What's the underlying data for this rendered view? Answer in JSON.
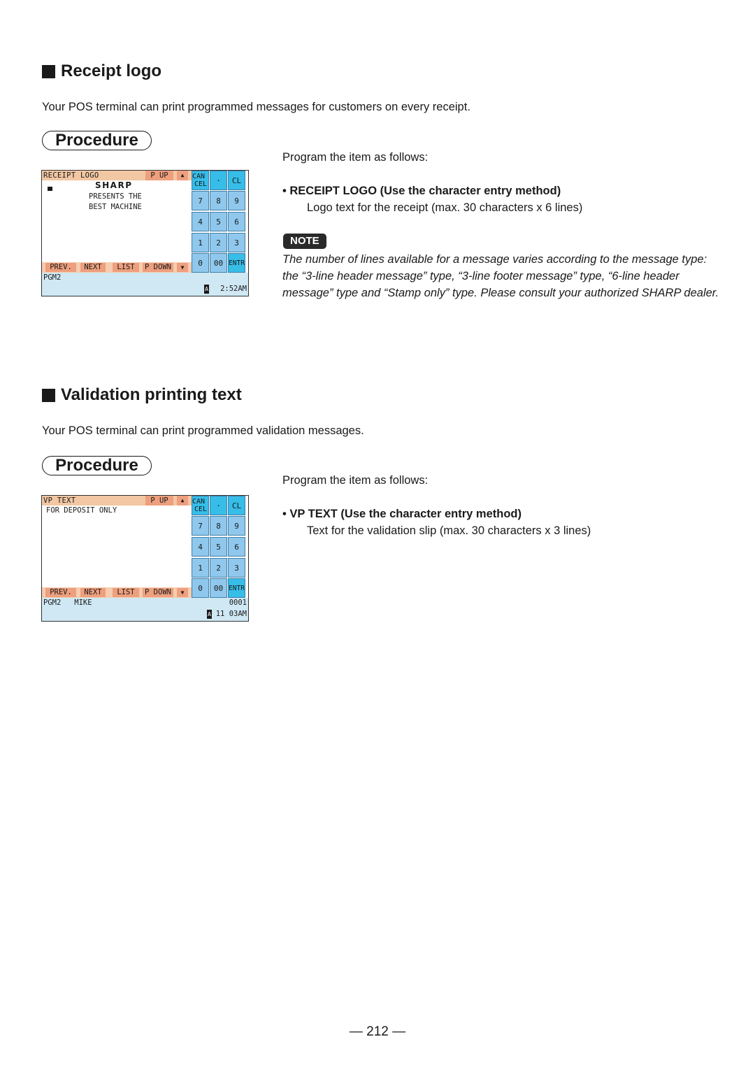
{
  "sections": [
    {
      "title": "Receipt logo",
      "intro": "Your POS terminal can print programmed messages for customers on every receipt.",
      "procedure_label": "Procedure",
      "program_text": "Program the item as follows:",
      "bullet_title": "RECEIPT LOGO (Use the character entry method)",
      "bullet_desc": "Logo text for the receipt (max. 30 characters x 6 lines)",
      "note_label": "NOTE",
      "note_text": "The number of lines available for a message varies according to the message type: the “3-line header message” type, “3-line footer message” type, “6-line header message” type and “Stamp only” type. Please consult your authorized SHARP dealer.",
      "screen": {
        "title": "RECEIPT LOGO",
        "content_lines": [
          "SHARP",
          "PRESENTS THE",
          "BEST MACHINE"
        ],
        "status_left": "PGM2",
        "status_right_top": "",
        "mode_indicator": "A",
        "time": "2:52AM"
      }
    },
    {
      "title": "Validation printing text",
      "intro": "Your POS terminal can print programmed validation messages.",
      "procedure_label": "Procedure",
      "program_text": "Program the item as follows:",
      "bullet_title": "VP TEXT (Use the character entry method)",
      "bullet_desc": "Text for the validation slip (max. 30 characters x 3 lines)",
      "screen": {
        "title": "VP TEXT",
        "content_lines": [
          "FOR DEPOSIT ONLY"
        ],
        "status_left": "PGM2   MIKE",
        "status_right_top": "0001",
        "mode_indicator": "A",
        "time": "11 03AM"
      }
    }
  ],
  "pos_common": {
    "page_up": "P UP",
    "up_arrow_icon": "▲",
    "nav_buttons": [
      "PREV.",
      "NEXT",
      "LIST",
      "P DOWN"
    ],
    "down_arrow_icon": "▼",
    "keys": {
      "cancel_line1": "CAN",
      "cancel_line2": "CEL",
      "dot": "·",
      "clear": "CL",
      "k7": "7",
      "k8": "8",
      "k9": "9",
      "k4": "4",
      "k5": "5",
      "k6": "6",
      "k1": "1",
      "k2": "2",
      "k3": "3",
      "k0": "0",
      "k00": "00",
      "enter": "ENTR"
    }
  },
  "colors": {
    "title_bar": "#f2c7a3",
    "button_salmon": "#ee9f7e",
    "key_light_blue": "#8fc8ec",
    "key_bright_blue": "#36bde8",
    "status_bar": "#cfe8f4"
  },
  "page_number": "— 212 —"
}
